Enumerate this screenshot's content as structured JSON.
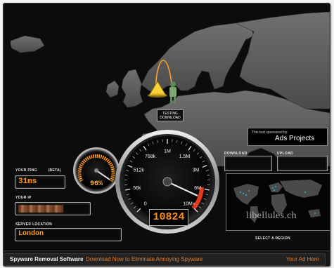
{
  "labels": {
    "ping": "YOUR PING",
    "ping_beta": "(beta)",
    "ip": "YOUR IP",
    "server": "SERVER LOCATION",
    "download": "DOWNLOAD",
    "upload": "UPLOAD",
    "select_region": "SELECT A REGION"
  },
  "values": {
    "ping": "31ms",
    "ip": "",
    "server": "London",
    "download": "",
    "upload": ""
  },
  "testing_button": {
    "line1": "TESTING",
    "line2": "DOWNLOAD"
  },
  "sponsor": {
    "label": "This test sponsored by:",
    "name": "Ads Projects"
  },
  "speedometer": {
    "ticks": [
      "0",
      "56k",
      "512k",
      "768k",
      "1M",
      "1.5M",
      "3M",
      "6M",
      "10M+"
    ],
    "display": "10824"
  },
  "ping_gauge": {
    "percent_text": "96%",
    "percent": 96
  },
  "bottom_bar": {
    "title": "Spyware Removal Software",
    "subtitle": "Download Now to Eliminate Annoying Spyware",
    "ad_link": "Your Ad Here"
  },
  "watermark": "libellules.ch",
  "colors": {
    "accent": "#ff8a1a",
    "background": "#0c0c0c",
    "land": "#5a5a5a",
    "sea": "#0c0c0c"
  }
}
